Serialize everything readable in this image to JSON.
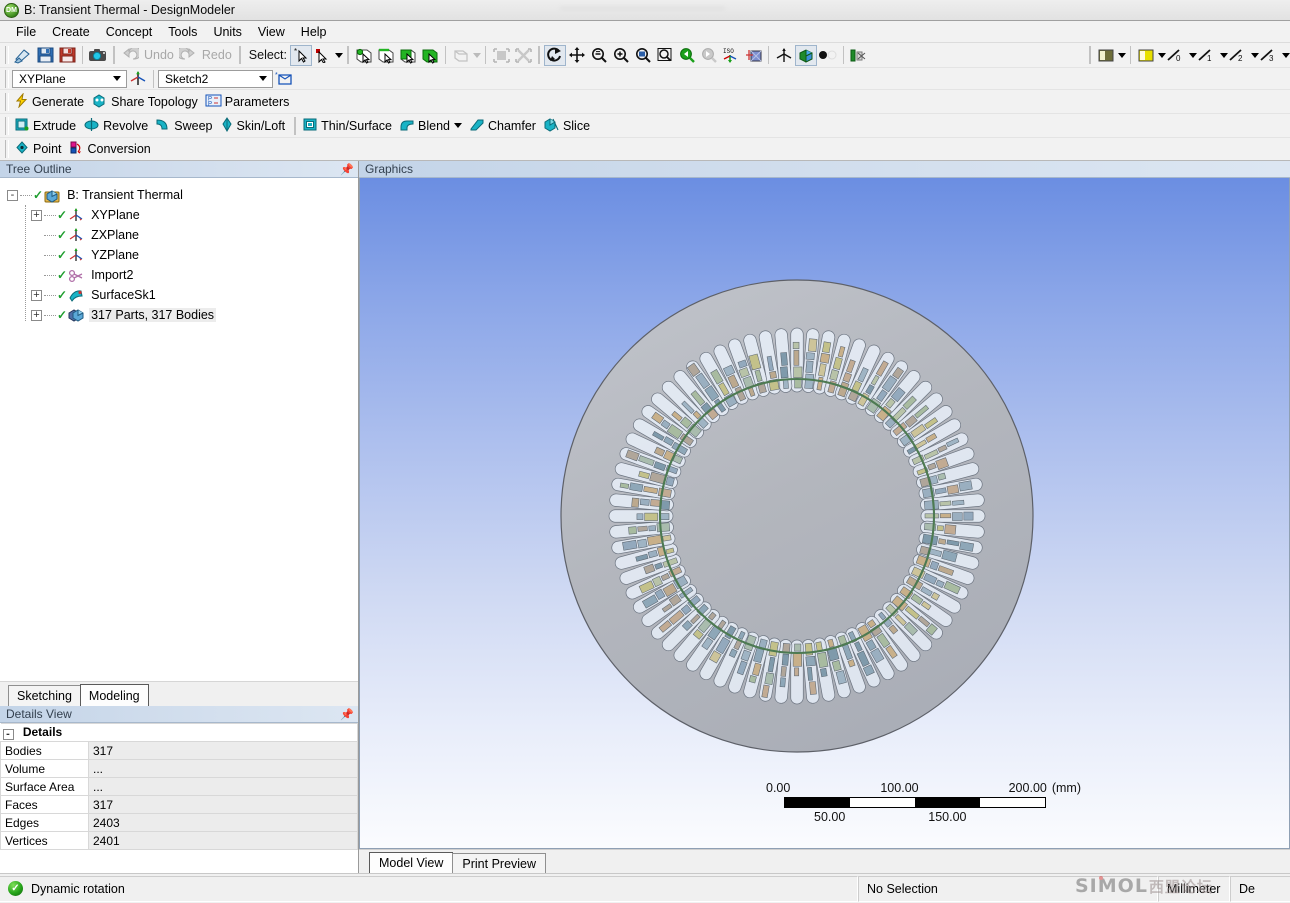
{
  "window": {
    "title": "B: Transient Thermal - DesignModeler",
    "app_icon": "designmodeler-icon",
    "watermark_blurred": "———————————————"
  },
  "menubar": {
    "items": [
      "File",
      "Create",
      "Concept",
      "Tools",
      "Units",
      "View",
      "Help"
    ]
  },
  "toolbar_standard": {
    "select_label": "Select:",
    "undo_label": "Undo",
    "redo_label": "Redo",
    "buttons": [
      "new-icon",
      "save-icon",
      "save-as-icon",
      "screenshot-icon",
      "undo-icon",
      "redo-icon",
      "select-single-icon",
      "select-box-icon",
      "select-vertex-icon",
      "select-edge-icon",
      "select-face-icon",
      "select-body-icon",
      "select-filter-icon",
      "extend-to-limits-icon",
      "extend-to-adjacent-icon",
      "rotate-icon",
      "pan-icon",
      "zoom-icon",
      "box-zoom-icon",
      "zoom-to-fit-icon",
      "magnifier-icon",
      "previous-view-icon",
      "next-view-icon",
      "iso-view-icon",
      "look-at-icon",
      "display-plane-icon",
      "display-model-icon",
      "point-display-icon",
      "edge-display-icon"
    ]
  },
  "toolbar_plane": {
    "plane_value": "XYPlane",
    "sketch_value": "Sketch2",
    "new_plane_icon": "new-plane-icon",
    "new_sketch_icon": "new-sketch-icon"
  },
  "toolbar_graphics_options": {
    "buttons": [
      "display-edges-icon",
      "display-faces-icon",
      "thickness-0-icon",
      "thickness-1-icon",
      "thickness-2-icon",
      "thickness-3-icon"
    ],
    "thickness_labels": [
      "0",
      "1",
      "2",
      "3"
    ]
  },
  "toolbar_generate": {
    "items": [
      {
        "label": "Generate",
        "icon": "lightning-icon"
      },
      {
        "label": "Share Topology",
        "icon": "share-topology-icon"
      },
      {
        "label": "Parameters",
        "icon": "parameters-icon"
      }
    ]
  },
  "toolbar_features": {
    "group1": [
      {
        "label": "Extrude",
        "icon": "extrude-icon"
      },
      {
        "label": "Revolve",
        "icon": "revolve-icon"
      },
      {
        "label": "Sweep",
        "icon": "sweep-icon"
      },
      {
        "label": "Skin/Loft",
        "icon": "skin-loft-icon"
      }
    ],
    "group2": [
      {
        "label": "Thin/Surface",
        "icon": "thin-surface-icon"
      },
      {
        "label": "Blend",
        "icon": "blend-icon",
        "dropdown": true
      },
      {
        "label": "Chamfer",
        "icon": "chamfer-icon"
      },
      {
        "label": "Slice",
        "icon": "slice-icon"
      }
    ]
  },
  "toolbar_point": {
    "items": [
      {
        "label": "Point",
        "icon": "point-icon"
      },
      {
        "label": "Conversion",
        "icon": "conversion-icon"
      }
    ]
  },
  "tree_panel": {
    "title": "Tree Outline",
    "pin_icon": "pin-icon",
    "nodes": [
      {
        "label": "B: Transient Thermal",
        "depth": 0,
        "expander": "-",
        "icon": "project-icon",
        "check": true,
        "selected": false
      },
      {
        "label": "XYPlane",
        "depth": 1,
        "expander": "+",
        "icon": "plane-icon",
        "check": true,
        "selected": false
      },
      {
        "label": "ZXPlane",
        "depth": 1,
        "expander": "",
        "icon": "plane-icon",
        "check": true,
        "selected": false
      },
      {
        "label": "YZPlane",
        "depth": 1,
        "expander": "",
        "icon": "plane-icon",
        "check": true,
        "selected": false
      },
      {
        "label": "Import2",
        "depth": 1,
        "expander": "",
        "icon": "import-icon",
        "check": true,
        "selected": false
      },
      {
        "label": "SurfaceSk1",
        "depth": 1,
        "expander": "+",
        "icon": "surface-icon",
        "check": true,
        "selected": false
      },
      {
        "label": "317 Parts, 317 Bodies",
        "depth": 1,
        "expander": "+",
        "icon": "bodies-icon",
        "check": true,
        "selected": true
      }
    ]
  },
  "sketch_tabs": {
    "tabs": [
      {
        "label": "Sketching",
        "active": false
      },
      {
        "label": "Modeling",
        "active": true
      }
    ]
  },
  "details_panel": {
    "title": "Details View",
    "pin_icon": "pin-icon",
    "group_label": "Details",
    "group_expander": "-",
    "rows": [
      {
        "key": "Bodies",
        "value": "317"
      },
      {
        "key": "Volume",
        "value": "..."
      },
      {
        "key": "Surface Area",
        "value": "..."
      },
      {
        "key": "Faces",
        "value": "317"
      },
      {
        "key": "Edges",
        "value": "2403"
      },
      {
        "key": "Vertices",
        "value": "2401"
      }
    ]
  },
  "graphics": {
    "title": "Graphics",
    "model_name": "stator-cross-section",
    "background_top": "#6b8ee2",
    "background_bottom": "#fbfcfe",
    "disc_color": "#b4b7bf",
    "inner_circle_color": "#4d7a52",
    "slot_count": 72,
    "scale_bar": {
      "unit": "(mm)",
      "top_labels": [
        "0.00",
        "100.00",
        "200.00"
      ],
      "bottom_labels": [
        "50.00",
        "150.00"
      ]
    }
  },
  "view_tabs": {
    "tabs": [
      {
        "label": "Model View",
        "active": true
      },
      {
        "label": "Print Preview",
        "active": false
      }
    ]
  },
  "statusbar": {
    "status_icon": "ok-check-icon",
    "status_text": "Dynamic rotation",
    "selection_text": "No Selection",
    "unit_text": "Millimeter",
    "angle_text": "De",
    "watermark_primary": "SIMOL",
    "watermark_secondary": "西盟论坛"
  }
}
